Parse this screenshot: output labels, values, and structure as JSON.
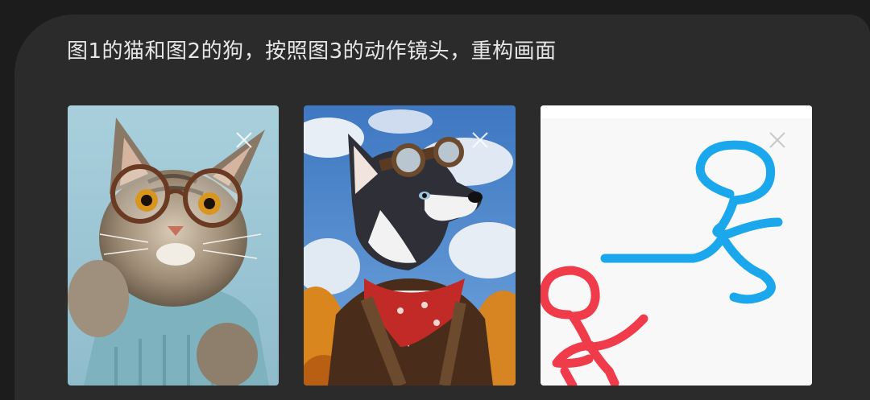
{
  "prompt": {
    "text": "图1的猫和图2的狗，按照图3的动作镜头，重构画面"
  },
  "thumbnails": [
    {
      "depicts": "cat-with-glasses",
      "icon": "close-icon"
    },
    {
      "depicts": "husky-dog-aviator",
      "icon": "close-icon"
    },
    {
      "depicts": "stick-figure-sketch",
      "icon": "close-icon"
    }
  ],
  "colors": {
    "background": "#1c1c1c",
    "card": "#2b2b2b",
    "prompt_text": "#e6e6e6",
    "sketch_blue": "#1aa7ec",
    "sketch_red": "#ef3b4a"
  }
}
